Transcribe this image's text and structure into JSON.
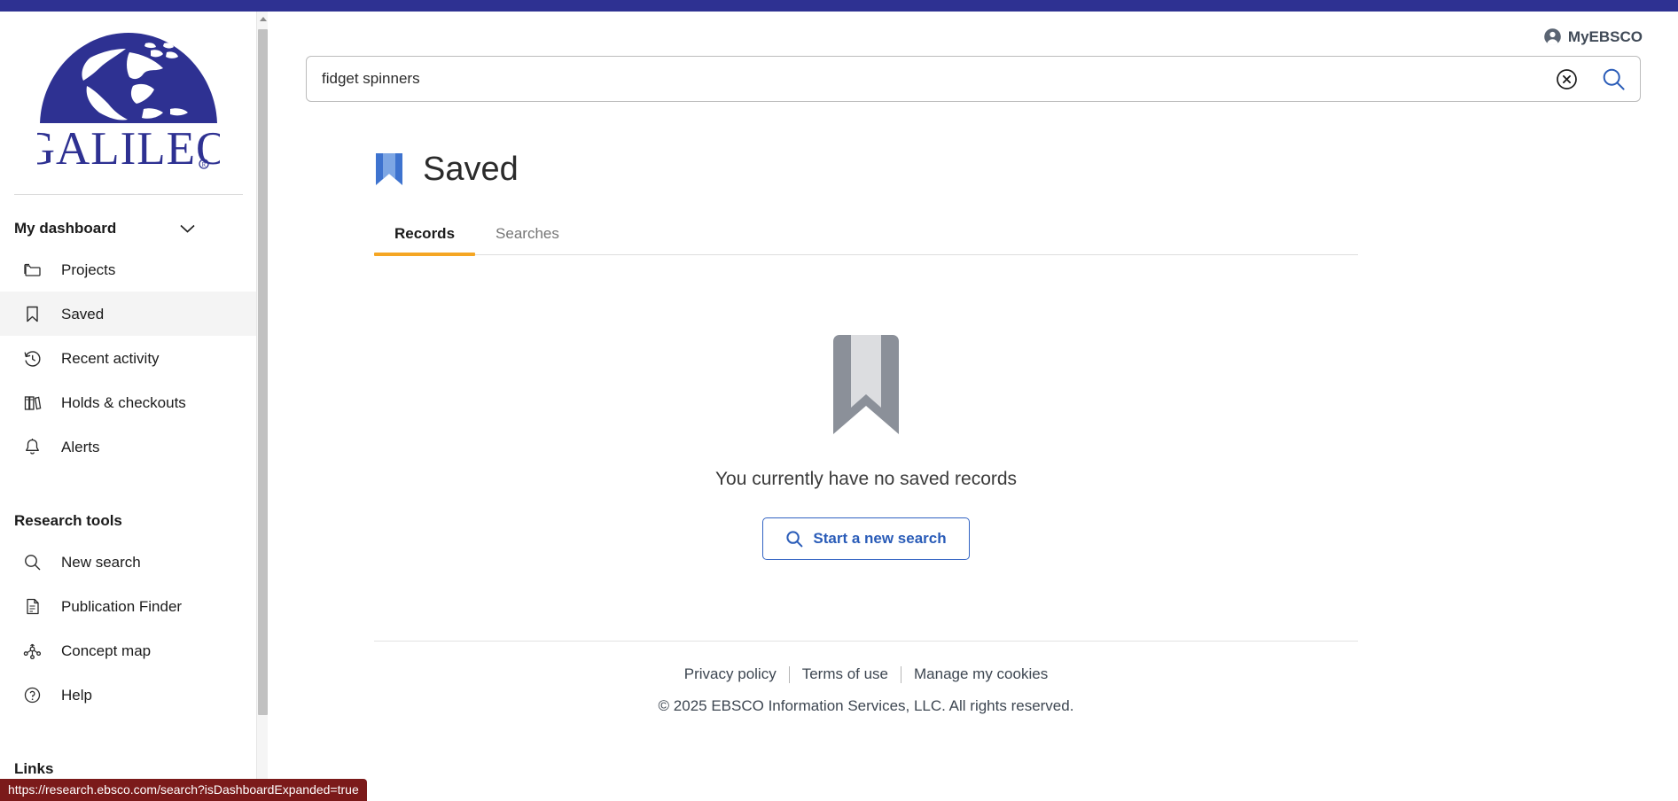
{
  "brand": {
    "top_bar_color": "#2e3192",
    "logo_text": "GALILEO",
    "logo_color": "#2e3192"
  },
  "sidebar": {
    "dashboard_section": {
      "title": "My dashboard",
      "chevron_icon": "chevron-down-icon",
      "items": [
        {
          "label": "Projects",
          "icon": "folder-icon",
          "active": false
        },
        {
          "label": "Saved",
          "icon": "bookmark-icon",
          "active": true
        },
        {
          "label": "Recent activity",
          "icon": "history-icon",
          "active": false
        },
        {
          "label": "Holds & checkouts",
          "icon": "books-icon",
          "active": false
        },
        {
          "label": "Alerts",
          "icon": "bell-icon",
          "active": false
        }
      ]
    },
    "research_section": {
      "title": "Research tools",
      "items": [
        {
          "label": "New search",
          "icon": "search-icon"
        },
        {
          "label": "Publication Finder",
          "icon": "document-icon"
        },
        {
          "label": "Concept map",
          "icon": "concept-map-icon"
        },
        {
          "label": "Help",
          "icon": "help-circle-icon"
        }
      ]
    },
    "links_section": {
      "title": "Links"
    }
  },
  "header": {
    "account_label": "MyEBSCO",
    "account_icon": "user-circle-icon"
  },
  "search": {
    "value": "fidget spinners",
    "placeholder": "",
    "clear_icon": "clear-circle-icon",
    "submit_icon": "search-icon"
  },
  "main": {
    "page_title": "Saved",
    "page_title_icon": "bookmark-icon",
    "tabs": [
      {
        "label": "Records",
        "active": true
      },
      {
        "label": "Searches",
        "active": false
      }
    ],
    "empty_state": {
      "icon": "bookmark-large-icon",
      "message": "You currently have no saved records",
      "button_label": "Start a new search",
      "button_icon": "search-icon"
    }
  },
  "footer": {
    "links": [
      "Privacy policy",
      "Terms of use",
      "Manage my cookies"
    ],
    "copyright": "© 2025 EBSCO Information Services, LLC. All rights reserved."
  },
  "status_bar": {
    "url": "https://research.ebsco.com/search?isDashboardExpanded=true"
  },
  "colors": {
    "accent_orange": "#f5a623",
    "link_blue": "#2a5cb8",
    "brand_indigo": "#2e3192",
    "status_bar_red": "#7b1a1a"
  }
}
